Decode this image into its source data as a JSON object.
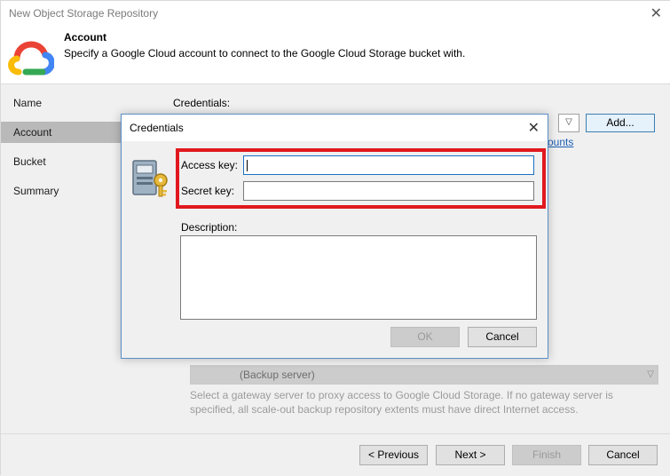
{
  "window": {
    "title": "New Object Storage Repository",
    "close_glyph": "✕"
  },
  "header": {
    "title": "Account",
    "subtitle": "Specify a Google Cloud account to connect to the Google Cloud Storage bucket with."
  },
  "nav": {
    "items": [
      {
        "label": "Name",
        "active": false
      },
      {
        "label": "Account",
        "active": true
      },
      {
        "label": "Bucket",
        "active": false
      },
      {
        "label": "Summary",
        "active": false
      }
    ]
  },
  "content": {
    "credentials_label": "Credentials:",
    "add_button": "Add...",
    "accounts_link_fragment": "ounts",
    "gateway_select_value": "(Backup server)",
    "gateway_help": "Select a gateway server to proxy access to Google Cloud Storage. If no gateway server is specified, all scale-out backup repository extents must have direct Internet access."
  },
  "footer": {
    "previous": "< Previous",
    "next": "Next >",
    "finish": "Finish",
    "cancel": "Cancel"
  },
  "dialog": {
    "title": "Credentials",
    "close_glyph": "✕",
    "access_key_label": "Access key:",
    "access_key_value": "",
    "secret_key_label": "Secret key:",
    "secret_key_value": "",
    "description_label": "Description:",
    "description_value": "",
    "ok_button": "OK",
    "cancel_button": "Cancel"
  },
  "colors": {
    "highlight": "#e0191f",
    "nav_active": "#b9b9b9",
    "link": "#1a5fb4"
  },
  "icons": [
    "google-cloud-logo-icon",
    "credentials-key-icon",
    "close-icon",
    "chevron-down-icon"
  ]
}
